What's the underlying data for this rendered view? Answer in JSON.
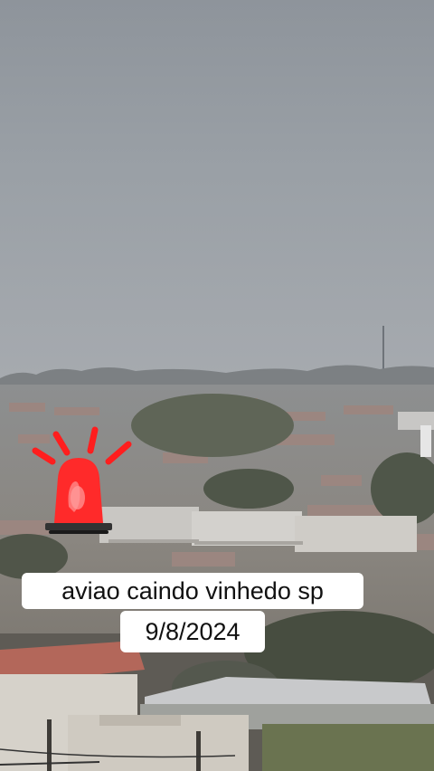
{
  "scene": {
    "description_icon": "city-skyline-photo",
    "sky_color": "#8f959c",
    "haze_color": "#a3a8ae"
  },
  "overlay": {
    "siren_icon": "emergency-siren-icon",
    "siren_color": "#ff2a2a",
    "caption_line1": "aviao caindo vinhedo sp",
    "caption_line2": "9/8/2024"
  }
}
